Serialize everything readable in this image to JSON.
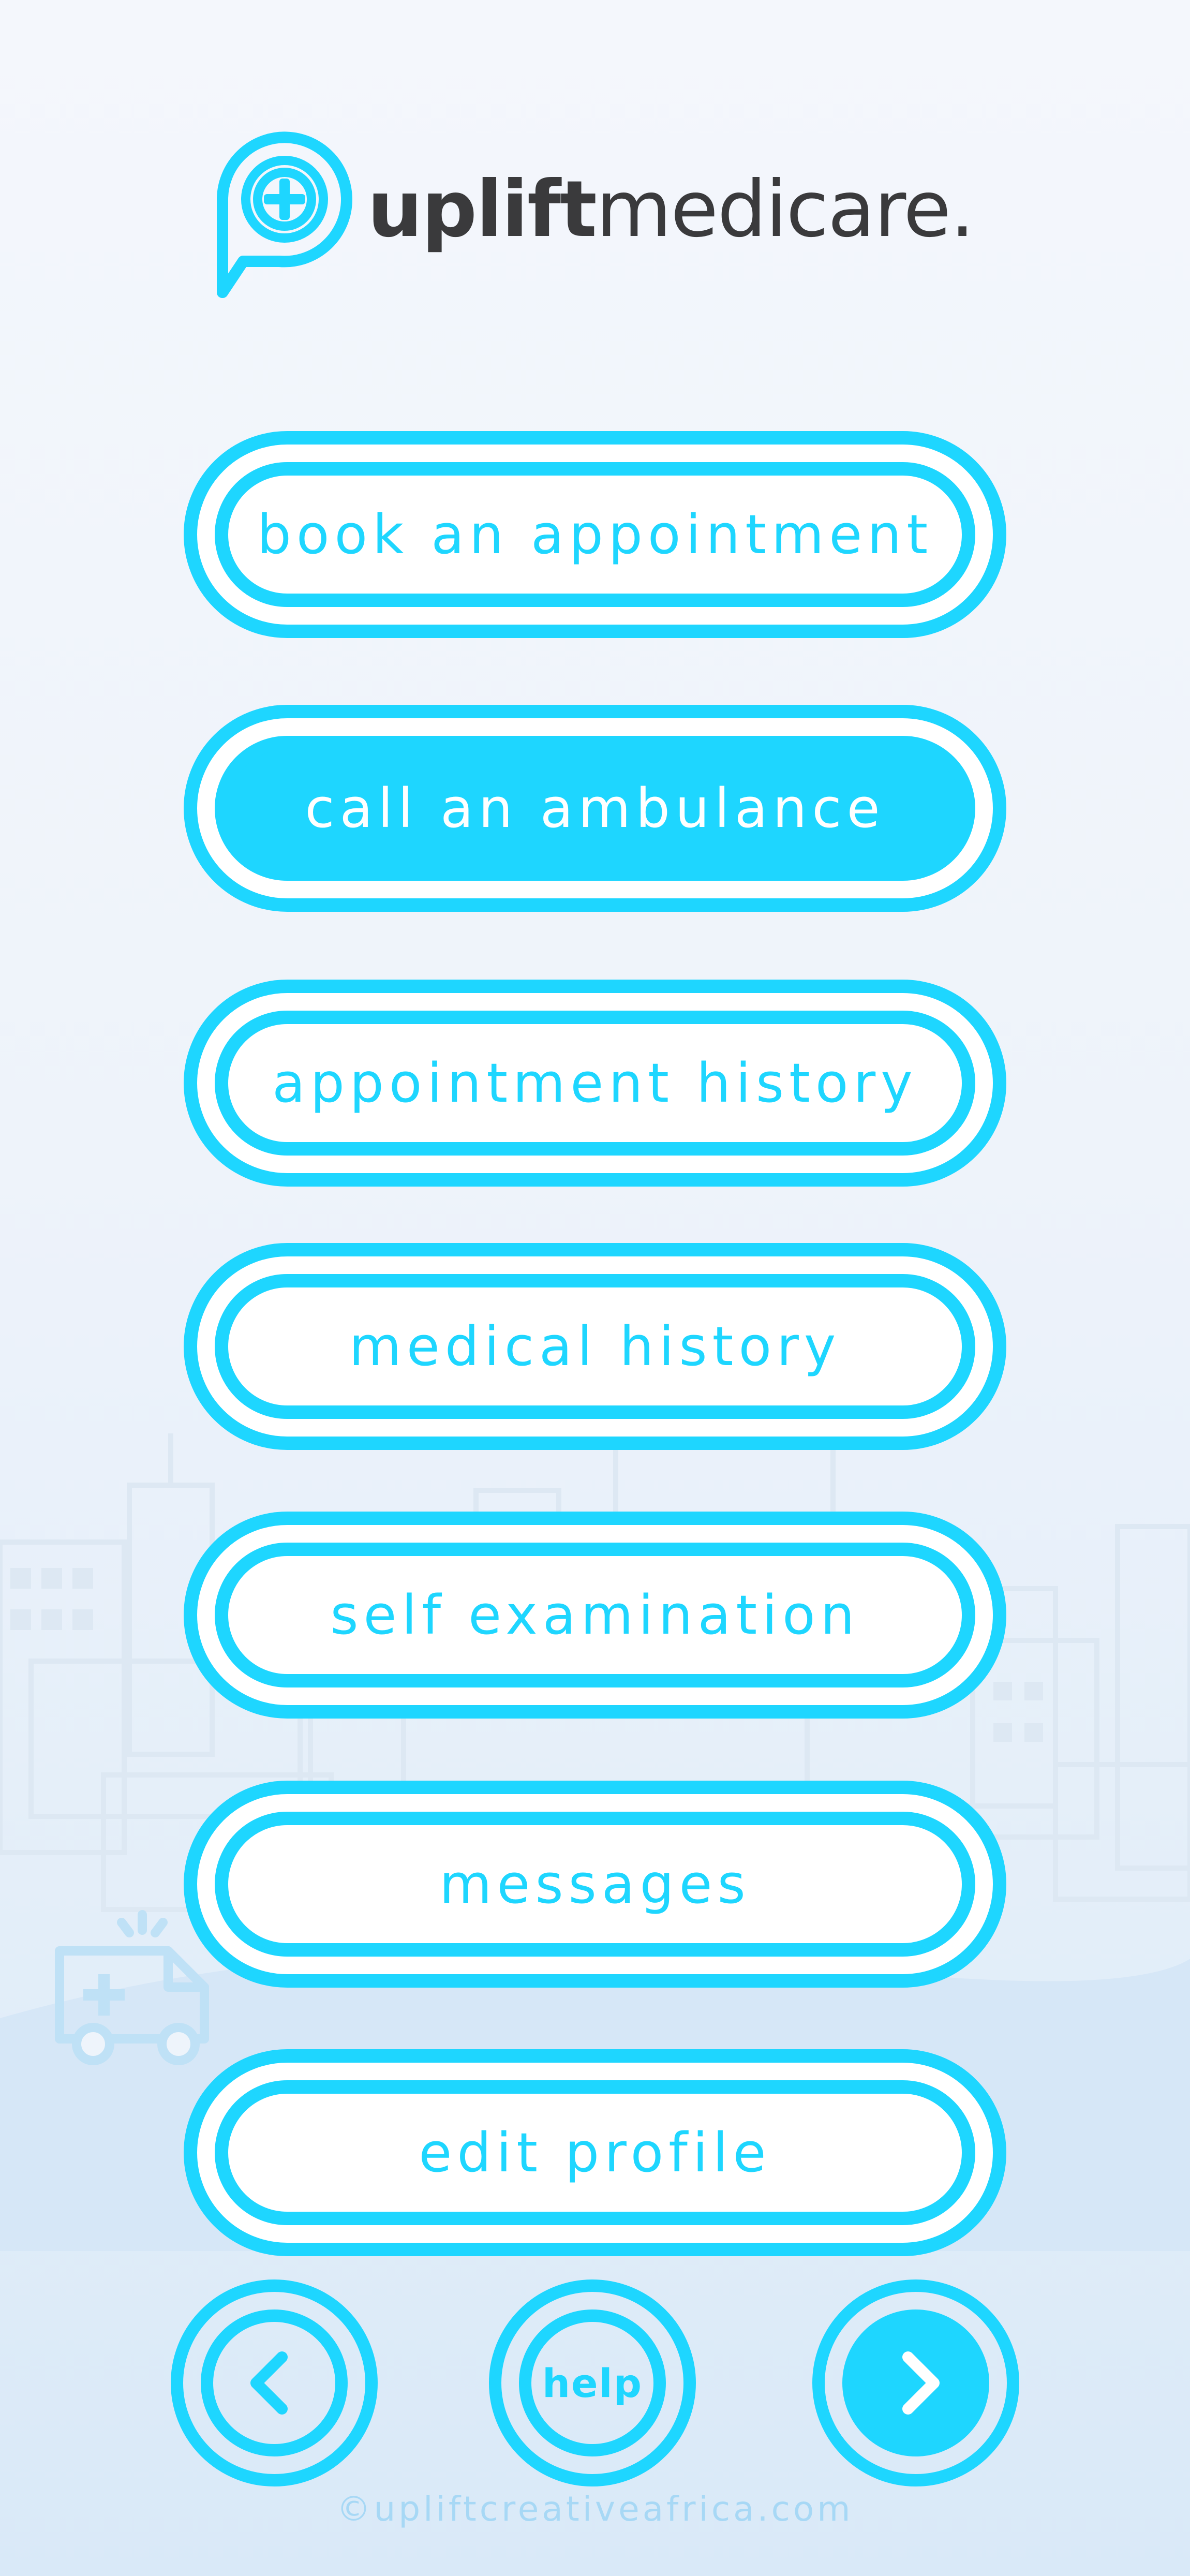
{
  "brand": {
    "name_bold": "uplift",
    "name_light": "medicare.",
    "accent": "#1ed6ff",
    "text_color": "#3a3a3c"
  },
  "menu": [
    {
      "label": "book an appointment",
      "active": false
    },
    {
      "label": "call an ambulance",
      "active": true
    },
    {
      "label": "appointment history",
      "active": false
    },
    {
      "label": "medical history",
      "active": false
    },
    {
      "label": "self examination",
      "active": false
    },
    {
      "label": "messages",
      "active": false
    },
    {
      "label": "edit profile",
      "active": false
    }
  ],
  "nav": {
    "back_icon": "chevron-left-icon",
    "help_label": "help",
    "next_icon": "chevron-right-icon"
  },
  "footer": {
    "copyright": "©upliftcreativeafrica.com"
  }
}
